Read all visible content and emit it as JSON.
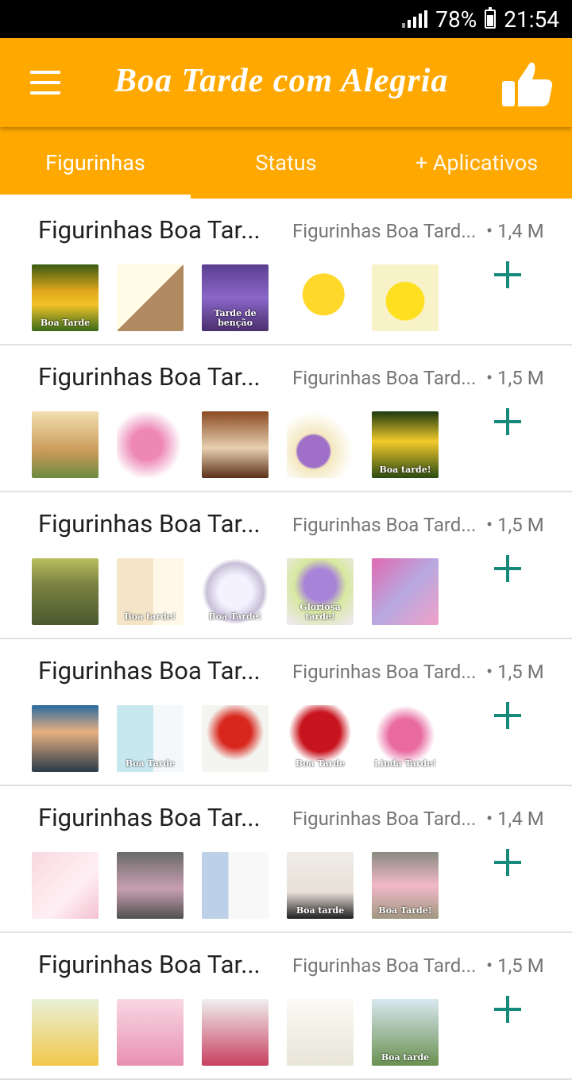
{
  "status_bar": {
    "battery_percent": "78%",
    "time": "21:54"
  },
  "app_bar": {
    "title": "Boa Tarde com Alegria",
    "menu_icon": "hamburger-menu-icon",
    "like_icon": "thumbs-up-icon"
  },
  "tabs": [
    "Figurinhas",
    "Status",
    "+ Aplicativos"
  ],
  "accent_color": "#ffa800",
  "add_color": "#16897a",
  "packs": [
    {
      "title": "Figurinhas Boa Tar...",
      "author": "Figurinhas Boa Tard...",
      "size": "• 1,4 M",
      "stickers": [
        {
          "bg": "linear-gradient(#3a5a14,#e0a81a 40%,#f2c32a 60%,#3a6a18)",
          "cap": "Boa Tarde"
        },
        {
          "bg": "linear-gradient(135deg,#fffbe6 50%,#b08a60 50%)",
          "cap": ""
        },
        {
          "bg": "linear-gradient(#5b3f8f,#8a66c8 50%,#4a2f6e)",
          "cap": "Tarde de benção"
        },
        {
          "bg": "radial-gradient(circle at 55% 45%,#ffd82b 40%,#fff 41%)",
          "cap": ""
        },
        {
          "bg": "radial-gradient(circle at 50% 55%,#ffe020 38%,#f7f2c8 40%)",
          "cap": ""
        }
      ]
    },
    {
      "title": "Figurinhas Boa Tar...",
      "author": "Figurinhas Boa Tard...",
      "size": "• 1,5 M",
      "stickers": [
        {
          "bg": "linear-gradient(#f2dfb0,#c99a58 60%,#6d8a40)",
          "cap": ""
        },
        {
          "bg": "radial-gradient(circle at 45% 50%,#ee86b6 30%,#f7d2e3 55%,#fff 70%)",
          "cap": ""
        },
        {
          "bg": "linear-gradient(#8a4a22,#e8d0b0 55%,#5a3018)",
          "cap": ""
        },
        {
          "bg": "radial-gradient(circle at 40% 60%,#a070c8 28%,#f4e8c0 32%,#fff 70%)",
          "cap": ""
        },
        {
          "bg": "linear-gradient(#1d3a10,#f2c92a 45%,#2a4a12)",
          "cap": "Boa tarde!"
        }
      ]
    },
    {
      "title": "Figurinhas Boa Tar...",
      "author": "Figurinhas Boa Tard...",
      "size": "• 1,5 M",
      "stickers": [
        {
          "bg": "linear-gradient(#b8c060,#7a8040 40%,#4a5a30)",
          "cap": ""
        },
        {
          "bg": "linear-gradient(90deg,#f4e4c8 55%,#fff8e8 55%)",
          "cap": "Boa tarde!"
        },
        {
          "bg": "radial-gradient(circle,#f4f2ff 35%,#c8c0d8 60%,#fff 70%)",
          "cap": "Boa Tarde!"
        },
        {
          "bg": "radial-gradient(circle at 50% 40%,#a884d8 30%,#d8e8a0 50%,#f0e8f8)",
          "cap": "Gloriosa tarde!"
        },
        {
          "bg": "linear-gradient(135deg,#e06ab0,#b8a8e0 50%,#f0a0c8)",
          "cap": ""
        }
      ]
    },
    {
      "title": "Figurinhas Boa Tar...",
      "author": "Figurinhas Boa Tard...",
      "size": "• 1,5 M",
      "stickers": [
        {
          "bg": "linear-gradient(#2a6aa0,#e8b080 40%,#2a3a4a)",
          "cap": ""
        },
        {
          "bg": "linear-gradient(90deg,#c8e8f0 55%,#f4f8fa 55%)",
          "cap": "Boa Tarde"
        },
        {
          "bg": "radial-gradient(circle at 50% 40%,#d8281e 30%,#f4f4f0 55%)",
          "cap": ""
        },
        {
          "bg": "radial-gradient(circle at 50% 40%,#c8141e 38%,#fff 60%)",
          "cap": "Boa Tarde"
        },
        {
          "bg": "radial-gradient(circle at 50% 45%,#e86aa0 32%,#fff 60%)",
          "cap": "Linda Tarde!"
        }
      ]
    },
    {
      "title": "Figurinhas Boa Tar...",
      "author": "Figurinhas Boa Tard...",
      "size": "• 1,4 M",
      "stickers": [
        {
          "bg": "linear-gradient(135deg,#f8d8e0,#fff0f4 60%,#f4c0d0)",
          "cap": ""
        },
        {
          "bg": "linear-gradient(#6a6a6a,#c8a0b0 55%,#505050)",
          "cap": ""
        },
        {
          "bg": "linear-gradient(90deg,#bcd0e8 40%,#f8f8f8 40%)",
          "cap": ""
        },
        {
          "bg": "linear-gradient(#f0ece8,#e8e0d8 60%,#202020)",
          "cap": "Boa tarde"
        },
        {
          "bg": "linear-gradient(#8a8a80,#f2b8c8 50%,#a09880)",
          "cap": "Boa Tarde!"
        }
      ]
    },
    {
      "title": "Figurinhas Boa Tar...",
      "author": "Figurinhas Boa Tard...",
      "size": "• 1,5 M",
      "stickers": [
        {
          "bg": "linear-gradient(#e8f0d8,#f2c84a)",
          "cap": ""
        },
        {
          "bg": "linear-gradient(#f8d8e4,#e890b0)",
          "cap": ""
        },
        {
          "bg": "linear-gradient(#f0f0f0,#c84060)",
          "cap": ""
        },
        {
          "bg": "linear-gradient(#fbfbf4,#e8e4d8)",
          "cap": ""
        },
        {
          "bg": "linear-gradient(#d8e8f0,#6a9050)",
          "cap": "Boa tarde"
        }
      ]
    }
  ]
}
